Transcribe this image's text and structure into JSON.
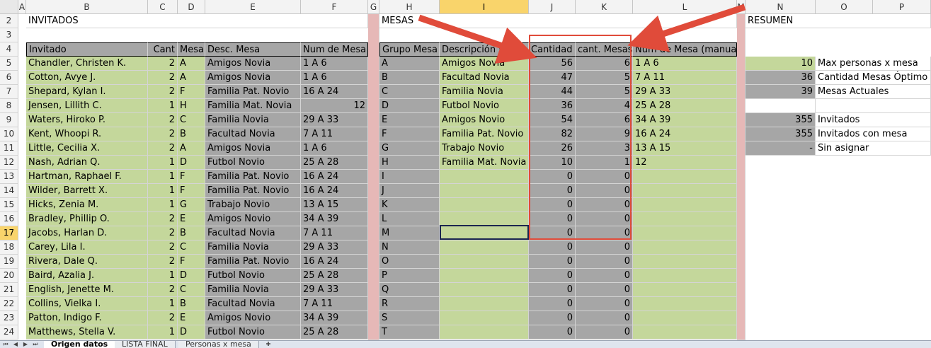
{
  "columns": [
    "A",
    "B",
    "C",
    "D",
    "E",
    "F",
    "G",
    "H",
    "I",
    "J",
    "K",
    "L",
    "M",
    "N",
    "O",
    "P"
  ],
  "selected_column": "I",
  "rows": [
    "2",
    "3",
    "4",
    "5",
    "6",
    "7",
    "8",
    "9",
    "10",
    "11",
    "12",
    "13",
    "14",
    "15",
    "16",
    "17",
    "18",
    "19",
    "20",
    "21",
    "22",
    "23",
    "24"
  ],
  "selected_row": "17",
  "titles": {
    "invitados": "INVITADOS",
    "mesas": "MESAS",
    "resumen": "RESUMEN"
  },
  "guest_headers": {
    "invitado": "Invitado",
    "cant": "Cant",
    "mesa": "Mesa",
    "desc": "Desc. Mesa",
    "num": "Num de Mesa"
  },
  "guests": [
    {
      "name": "Chandler, Christen K.",
      "cant": "2",
      "mesa": "A",
      "desc": "Amigos Novia",
      "num": "1 A 6"
    },
    {
      "name": "Cotton, Avye J.",
      "cant": "2",
      "mesa": "A",
      "desc": "Amigos Novia",
      "num": "1 A 6"
    },
    {
      "name": "Shepard, Kylan I.",
      "cant": "2",
      "mesa": "F",
      "desc": "Familia Pat. Novio",
      "num": "16 A 24"
    },
    {
      "name": "Jensen, Lillith C.",
      "cant": "1",
      "mesa": "H",
      "desc": "Familia Mat. Novia",
      "num": "12"
    },
    {
      "name": "Waters, Hiroko P.",
      "cant": "2",
      "mesa": "C",
      "desc": "Familia Novia",
      "num": "29 A 33"
    },
    {
      "name": "Kent, Whoopi R.",
      "cant": "2",
      "mesa": "B",
      "desc": "Facultad  Novia",
      "num": "7 A 11"
    },
    {
      "name": "Little, Cecilia X.",
      "cant": "2",
      "mesa": "A",
      "desc": "Amigos Novia",
      "num": "1 A 6"
    },
    {
      "name": "Nash, Adrian Q.",
      "cant": "1",
      "mesa": "D",
      "desc": "Futbol Novio",
      "num": "25 A 28"
    },
    {
      "name": "Hartman, Raphael F.",
      "cant": "1",
      "mesa": "F",
      "desc": "Familia Pat. Novio",
      "num": "16 A 24"
    },
    {
      "name": "Wilder, Barrett X.",
      "cant": "1",
      "mesa": "F",
      "desc": "Familia Pat. Novio",
      "num": "16 A 24"
    },
    {
      "name": "Hicks, Zenia M.",
      "cant": "1",
      "mesa": "G",
      "desc": "Trabajo Novio",
      "num": "13 A 15"
    },
    {
      "name": "Bradley, Phillip O.",
      "cant": "2",
      "mesa": "E",
      "desc": "Amigos Novio",
      "num": "34 A 39"
    },
    {
      "name": "Jacobs, Harlan D.",
      "cant": "2",
      "mesa": "B",
      "desc": "Facultad  Novia",
      "num": "7 A 11"
    },
    {
      "name": "Carey, Lila I.",
      "cant": "2",
      "mesa": "C",
      "desc": "Familia Novia",
      "num": "29 A 33"
    },
    {
      "name": "Rivera, Dale Q.",
      "cant": "2",
      "mesa": "F",
      "desc": "Familia Pat. Novio",
      "num": "16 A 24"
    },
    {
      "name": "Baird, Azalia J.",
      "cant": "1",
      "mesa": "D",
      "desc": "Futbol Novio",
      "num": "25 A 28"
    },
    {
      "name": "English, Jenette M.",
      "cant": "2",
      "mesa": "C",
      "desc": "Familia Novia",
      "num": "29 A 33"
    },
    {
      "name": "Collins, Vielka I.",
      "cant": "1",
      "mesa": "B",
      "desc": "Facultad  Novia",
      "num": "7 A 11"
    },
    {
      "name": "Patton, Indigo F.",
      "cant": "2",
      "mesa": "E",
      "desc": "Amigos Novio",
      "num": "34 A 39"
    },
    {
      "name": "Matthews, Stella V.",
      "cant": "1",
      "mesa": "D",
      "desc": "Futbol Novio",
      "num": "25 A 28"
    }
  ],
  "mesa_headers": {
    "grupo": "Grupo Mesa",
    "desc": "Descripción M",
    "cantidad": "Cantidad",
    "cant_mesas": "cant. Mesas",
    "manual": "Num de Mesa (manual)"
  },
  "mesas": [
    {
      "grupo": "A",
      "desc": "Amigos Novia",
      "cantidad": "56",
      "cant_mesas": "6",
      "manual": "1 A 6"
    },
    {
      "grupo": "B",
      "desc": "Facultad  Novia",
      "cantidad": "47",
      "cant_mesas": "5",
      "manual": "7 A 11"
    },
    {
      "grupo": "C",
      "desc": "Familia Novia",
      "cantidad": "44",
      "cant_mesas": "5",
      "manual": "29 A 33"
    },
    {
      "grupo": "D",
      "desc": "Futbol Novio",
      "cantidad": "36",
      "cant_mesas": "4",
      "manual": "25 A 28"
    },
    {
      "grupo": "E",
      "desc": "Amigos Novio",
      "cantidad": "54",
      "cant_mesas": "6",
      "manual": "34 A 39"
    },
    {
      "grupo": "F",
      "desc": "Familia Pat. Novio",
      "cantidad": "82",
      "cant_mesas": "9",
      "manual": "16 A 24"
    },
    {
      "grupo": "G",
      "desc": "Trabajo Novio",
      "cantidad": "26",
      "cant_mesas": "3",
      "manual": "13 A 15"
    },
    {
      "grupo": "H",
      "desc": "Familia Mat. Novia",
      "cantidad": "10",
      "cant_mesas": "1",
      "manual": "12"
    },
    {
      "grupo": "I",
      "desc": "",
      "cantidad": "0",
      "cant_mesas": "0",
      "manual": ""
    },
    {
      "grupo": "J",
      "desc": "",
      "cantidad": "0",
      "cant_mesas": "0",
      "manual": ""
    },
    {
      "grupo": "K",
      "desc": "",
      "cantidad": "0",
      "cant_mesas": "0",
      "manual": ""
    },
    {
      "grupo": "L",
      "desc": "",
      "cantidad": "0",
      "cant_mesas": "0",
      "manual": ""
    },
    {
      "grupo": "M",
      "desc": "",
      "cantidad": "0",
      "cant_mesas": "0",
      "manual": ""
    },
    {
      "grupo": "N",
      "desc": "",
      "cantidad": "0",
      "cant_mesas": "0",
      "manual": ""
    },
    {
      "grupo": "O",
      "desc": "",
      "cantidad": "0",
      "cant_mesas": "0",
      "manual": ""
    },
    {
      "grupo": "P",
      "desc": "",
      "cantidad": "0",
      "cant_mesas": "0",
      "manual": ""
    },
    {
      "grupo": "Q",
      "desc": "",
      "cantidad": "0",
      "cant_mesas": "0",
      "manual": ""
    },
    {
      "grupo": "R",
      "desc": "",
      "cantidad": "0",
      "cant_mesas": "0",
      "manual": ""
    },
    {
      "grupo": "S",
      "desc": "",
      "cantidad": "0",
      "cant_mesas": "0",
      "manual": ""
    },
    {
      "grupo": "T",
      "desc": "",
      "cantidad": "0",
      "cant_mesas": "0",
      "manual": ""
    }
  ],
  "resumen": [
    {
      "value": "10",
      "label": "Max personas x mesa",
      "style": "green"
    },
    {
      "value": "36",
      "label": "Cantidad Mesas Óptimo",
      "style": "grey"
    },
    {
      "value": "39",
      "label": "Mesas Actuales",
      "style": "grey"
    },
    {
      "value": "",
      "label": "",
      "style": "none"
    },
    {
      "value": "355",
      "label": "Invitados",
      "style": "grey"
    },
    {
      "value": "355",
      "label": "Invitados con mesa",
      "style": "grey"
    },
    {
      "value": "-",
      "label": "Sin asignar",
      "style": "grey"
    }
  ],
  "sheet_tabs": [
    "Origen datos",
    "LISTA FINAL",
    "Personas x mesa"
  ],
  "active_tab": "Origen datos",
  "colors": {
    "green": "#c4d79b",
    "grey": "#a6a6a6",
    "pink": "#e6b8b7",
    "header_blue": "#8db4e2",
    "highlight": "#e04b3a"
  }
}
